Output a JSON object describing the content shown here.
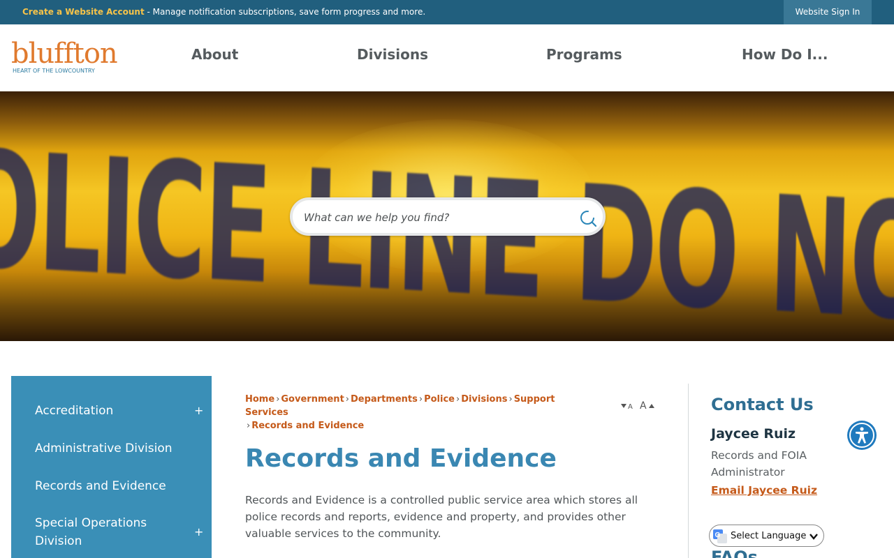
{
  "topbar": {
    "account_link": "Create a Website Account",
    "account_desc": " - Manage notification subscriptions, save form progress and more.",
    "signin": "Website Sign In"
  },
  "logo": {
    "word": "bluffton",
    "tagline": "HEART OF THE LOWCOUNTRY"
  },
  "nav": {
    "about": "About",
    "divisions": "Divisions",
    "programs": "Programs",
    "how": "How Do I..."
  },
  "hero": {
    "tape_text": "OLICE LINE DO NOT CROSS"
  },
  "search": {
    "placeholder": "What can we help you find?"
  },
  "sidebar": {
    "items": [
      {
        "label": "Accreditation",
        "expand": "+"
      },
      {
        "label": "Administrative Division"
      },
      {
        "label": "Records and Evidence"
      },
      {
        "label": "Special Operations Division",
        "expand": "+"
      }
    ]
  },
  "breadcrumb": {
    "items": [
      "Home",
      "Government",
      "Departments",
      "Police",
      "Divisions",
      "Support Services"
    ],
    "separator": "›",
    "current": "Records and Evidence"
  },
  "page": {
    "title": "Records and Evidence",
    "intro": "Records and Evidence is a controlled public service area which stores all police records and reports, evidence and property, and provides other valuable services to the community."
  },
  "text_resize": {
    "smaller": "A",
    "larger": "A"
  },
  "contact": {
    "title": "Contact Us",
    "name": "Jaycee Ruiz",
    "role": "Records and FOIA Administrator",
    "email_label": "Email Jaycee Ruiz"
  },
  "translate": {
    "label": "Select Language"
  },
  "faqs": {
    "title": "FAQs"
  },
  "colors": {
    "topbar": "#215f7e",
    "accent": "#c55a1a",
    "brand_blue": "#3a8fb7",
    "title_blue": "#3a87b2",
    "logo_orange": "#e07a2e"
  },
  "icons": {
    "search": "search-icon",
    "accessibility": "accessibility-icon",
    "google": "google-translate-icon",
    "chevron": "chevron-down-icon"
  }
}
